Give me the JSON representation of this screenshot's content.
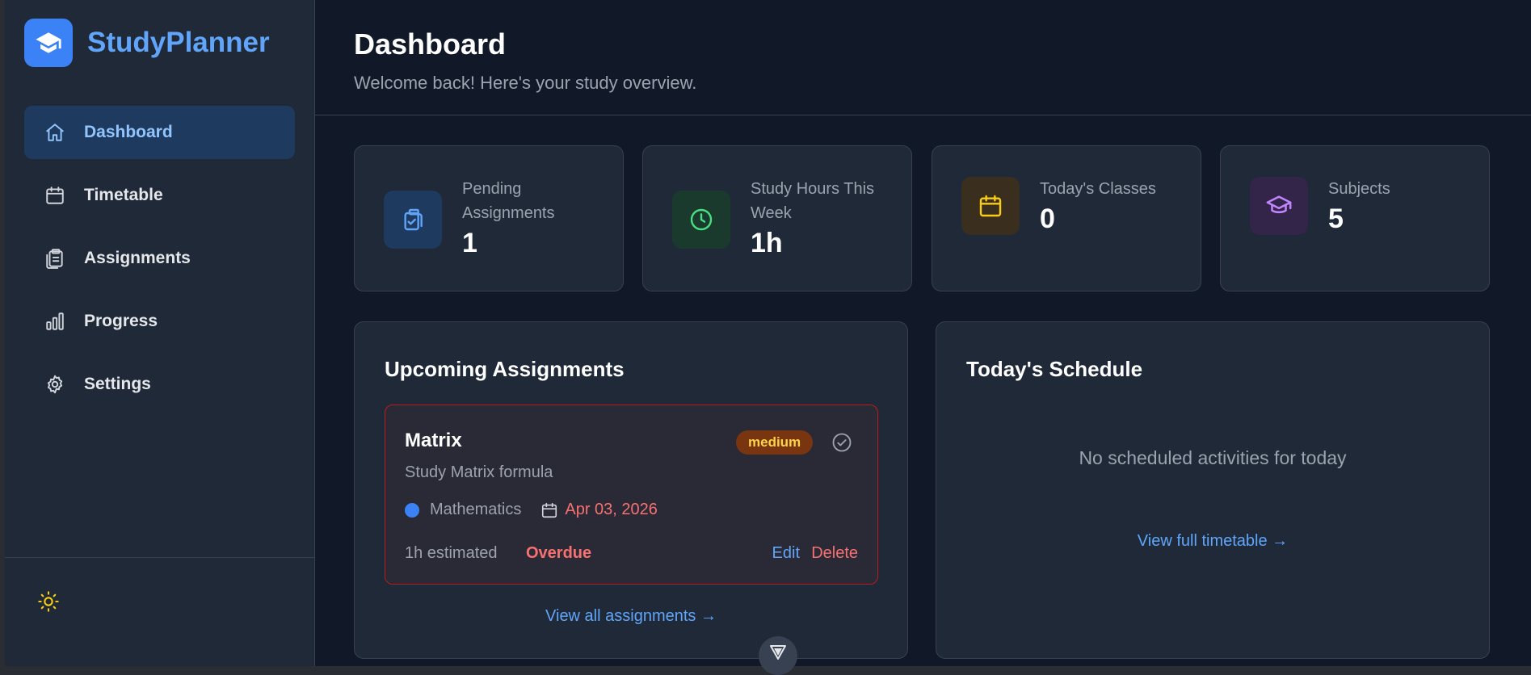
{
  "app": {
    "name": "StudyPlanner"
  },
  "sidebar": {
    "items": [
      {
        "label": "Dashboard",
        "icon": "home-icon",
        "active": true
      },
      {
        "label": "Timetable",
        "icon": "calendar-icon",
        "active": false
      },
      {
        "label": "Assignments",
        "icon": "clipboard-icon",
        "active": false
      },
      {
        "label": "Progress",
        "icon": "bar-chart-icon",
        "active": false
      },
      {
        "label": "Settings",
        "icon": "gear-icon",
        "active": false
      }
    ],
    "theme_toggle_icon": "sun-icon"
  },
  "header": {
    "title": "Dashboard",
    "subtitle": "Welcome back! Here's your study overview."
  },
  "stats": [
    {
      "label": "Pending Assignments",
      "value": "1",
      "icon": "clipboard-check-icon",
      "color": "#60a5fa"
    },
    {
      "label": "Study Hours This Week",
      "value": "1h",
      "icon": "clock-icon",
      "color": "#4ade80"
    },
    {
      "label": "Today's Classes",
      "value": "0",
      "icon": "calendar-icon",
      "color": "#facc15"
    },
    {
      "label": "Subjects",
      "value": "5",
      "icon": "graduation-cap-icon",
      "color": "#c084fc"
    }
  ],
  "upcoming": {
    "title": "Upcoming Assignments",
    "assignments": [
      {
        "title": "Matrix",
        "priority": "medium",
        "description": "Study Matrix formula",
        "subject": "Mathematics",
        "subject_color": "#3b82f6",
        "due_date": "Apr 03, 2026",
        "estimate": "1h estimated",
        "status": "Overdue",
        "edit_label": "Edit",
        "delete_label": "Delete"
      }
    ],
    "view_all": "View all assignments →"
  },
  "schedule": {
    "title": "Today's Schedule",
    "empty_message": "No scheduled activities for today",
    "view_full": "View full timetable →"
  },
  "colors": {
    "accent": "#3b82f6",
    "danger": "#f87171",
    "background": "#111827",
    "surface": "#1f2937"
  }
}
